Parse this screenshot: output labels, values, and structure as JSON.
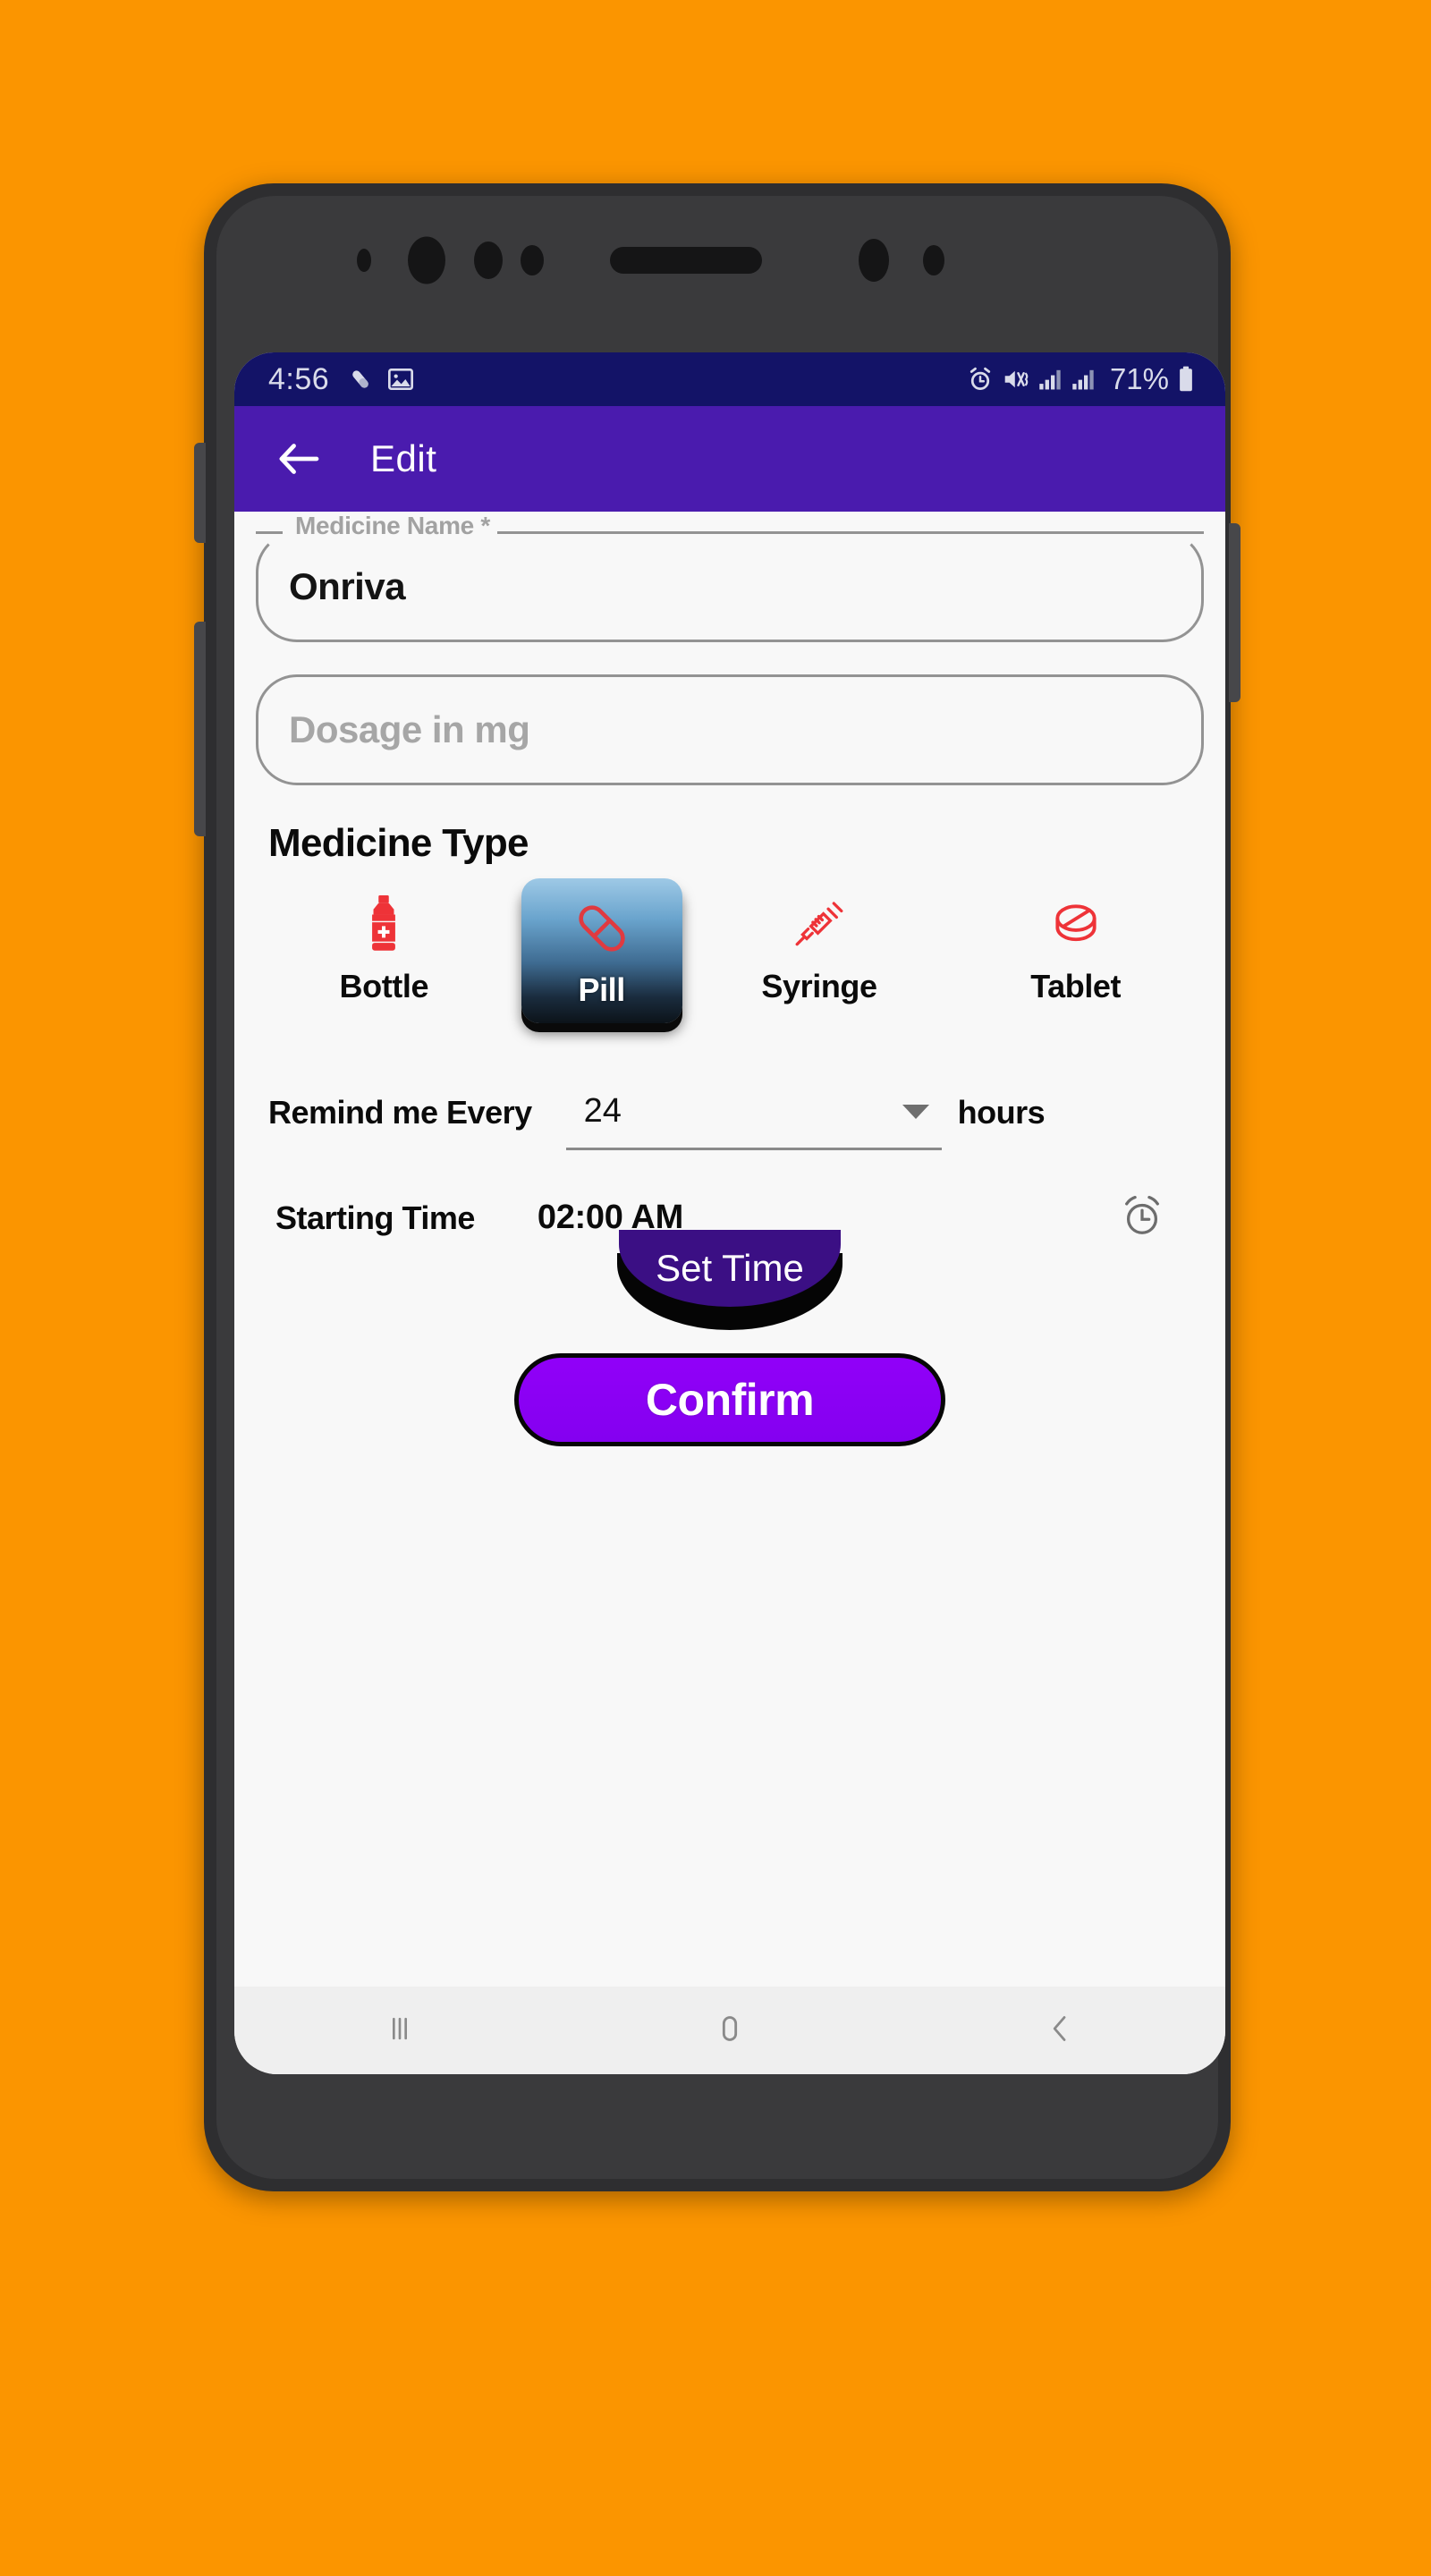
{
  "background_color": "#FB9500",
  "device": {
    "frame_color": "#2e2e30",
    "bezel_color": "#3a3a3c"
  },
  "status_bar": {
    "time": "4:56",
    "battery_percent": "71%",
    "background_color": "#131367",
    "left_icons": [
      "pill-notification-icon",
      "gallery-image-icon"
    ],
    "right_icons": [
      "alarm-icon",
      "mute-vibrate-icon",
      "signal-bars-icon-1",
      "signal-bars-icon-2",
      "battery-icon"
    ]
  },
  "app_bar": {
    "title": "Edit",
    "back_icon": "back-arrow-icon",
    "background_color": "#4A1BAE",
    "text_color": "#FFFFFF"
  },
  "form": {
    "medicine_name": {
      "label": "Medicine Name *",
      "value": "Onriva"
    },
    "dosage": {
      "placeholder": "Dosage in mg",
      "value": ""
    },
    "medicine_type": {
      "section_title": "Medicine Type",
      "selected": "Pill",
      "options": [
        {
          "label": "Bottle",
          "icon": "bottle-icon",
          "selected": false
        },
        {
          "label": "Pill",
          "icon": "pill-icon",
          "selected": true
        },
        {
          "label": "Syringe",
          "icon": "syringe-icon",
          "selected": false
        },
        {
          "label": "Tablet",
          "icon": "tablet-icon",
          "selected": false
        }
      ],
      "icon_color": "#EE3338"
    },
    "remind": {
      "label": "Remind me Every",
      "value": "24",
      "unit": "hours",
      "caret_icon": "chevron-down-icon"
    },
    "starting_time": {
      "label": "Starting Time",
      "value": "02:00 AM",
      "alarm_icon": "alarm-clock-icon"
    },
    "set_time_button": {
      "label": "Set Time",
      "color": "#3b0f84"
    },
    "confirm_button": {
      "label": "Confirm",
      "color": "#8C00F4"
    }
  },
  "nav_bar": {
    "buttons": [
      {
        "name": "recents-button",
        "icon": "recents-icon"
      },
      {
        "name": "home-button",
        "icon": "home-icon"
      },
      {
        "name": "back-button",
        "icon": "back-chevron-icon"
      }
    ],
    "background_color": "#EFEFEF"
  }
}
